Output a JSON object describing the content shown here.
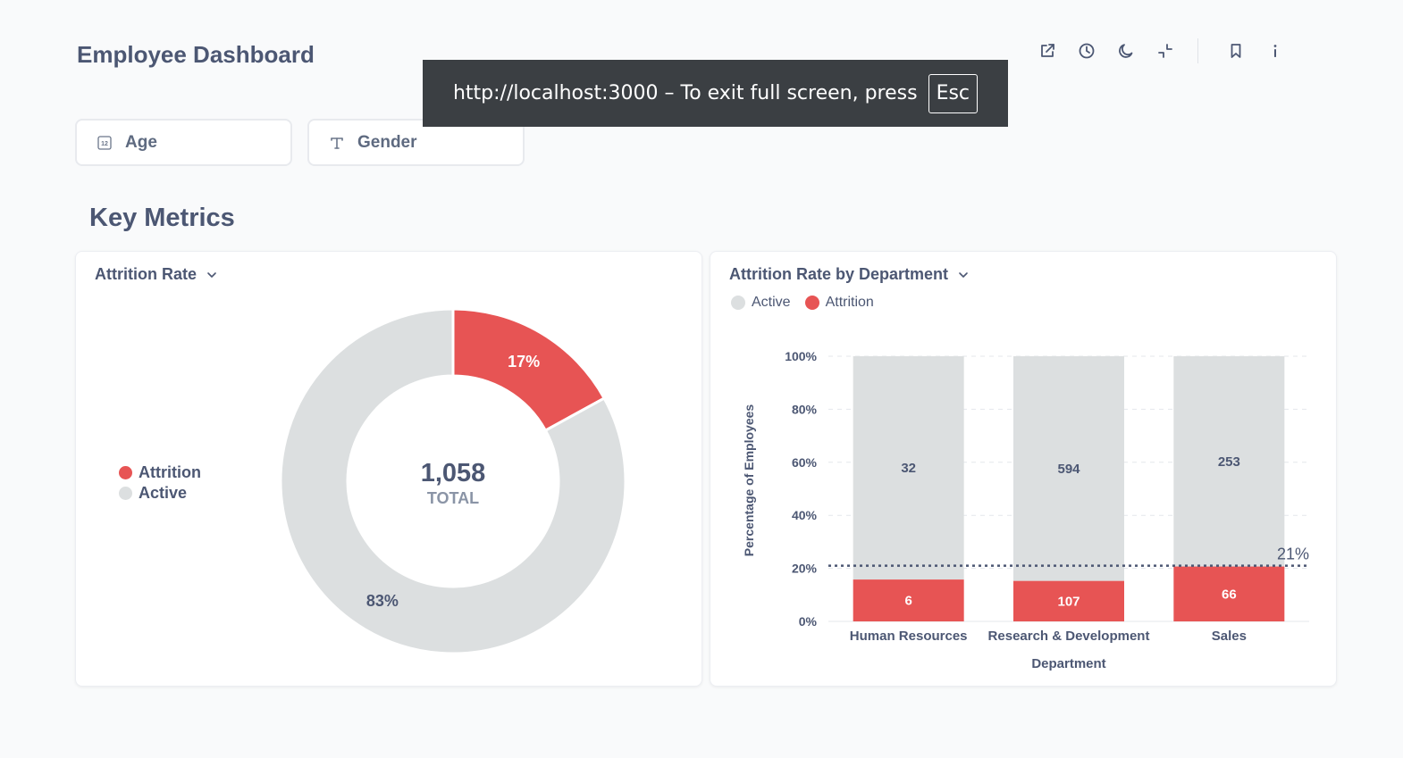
{
  "header": {
    "title": "Employee Dashboard",
    "actions": [
      {
        "name": "share-icon"
      },
      {
        "name": "clock-icon"
      },
      {
        "name": "moon-icon"
      },
      {
        "name": "exit-fullscreen-icon"
      },
      {
        "name": "bookmark-icon"
      },
      {
        "name": "info-icon"
      }
    ]
  },
  "toast": {
    "text": "http://localhost:3000 – To exit full screen, press",
    "key": "Esc"
  },
  "filters": [
    {
      "label": "Age",
      "icon": "number-icon"
    },
    {
      "label": "Gender",
      "icon": "text-type-icon"
    }
  ],
  "section": {
    "title": "Key Metrics"
  },
  "colors": {
    "attrition": "#e75454",
    "active": "#dcdfe0",
    "text": "#4c5773"
  },
  "cards": {
    "pie": {
      "title": "Attrition Rate",
      "center_value": "1,058",
      "center_label": "TOTAL",
      "legend": [
        "Attrition",
        "Active"
      ]
    },
    "bar": {
      "title": "Attrition Rate by Department",
      "legend": [
        "Active",
        "Attrition"
      ]
    }
  },
  "chart_data": [
    {
      "type": "pie",
      "title": "Attrition Rate",
      "slices": [
        {
          "name": "Attrition",
          "value": 17,
          "label": "17%"
        },
        {
          "name": "Active",
          "value": 83,
          "label": "83%"
        }
      ],
      "total": "1,058",
      "total_label": "TOTAL",
      "legend_position": "left"
    },
    {
      "type": "bar",
      "stacked": true,
      "title": "Attrition Rate by Department",
      "categories": [
        "Human Resources",
        "Research & Development",
        "Sales"
      ],
      "series": [
        {
          "name": "Attrition",
          "values": [
            6,
            107,
            66
          ]
        },
        {
          "name": "Active",
          "values": [
            32,
            594,
            253
          ]
        }
      ],
      "xlabel": "Department",
      "ylabel": "Percentage of Employees",
      "yticks": [
        "0%",
        "20%",
        "40%",
        "60%",
        "80%",
        "100%"
      ],
      "ylim": [
        0,
        100
      ],
      "goal_line": {
        "value": 21,
        "label": "21%"
      },
      "grid": true,
      "legend_position": "top-left"
    }
  ]
}
